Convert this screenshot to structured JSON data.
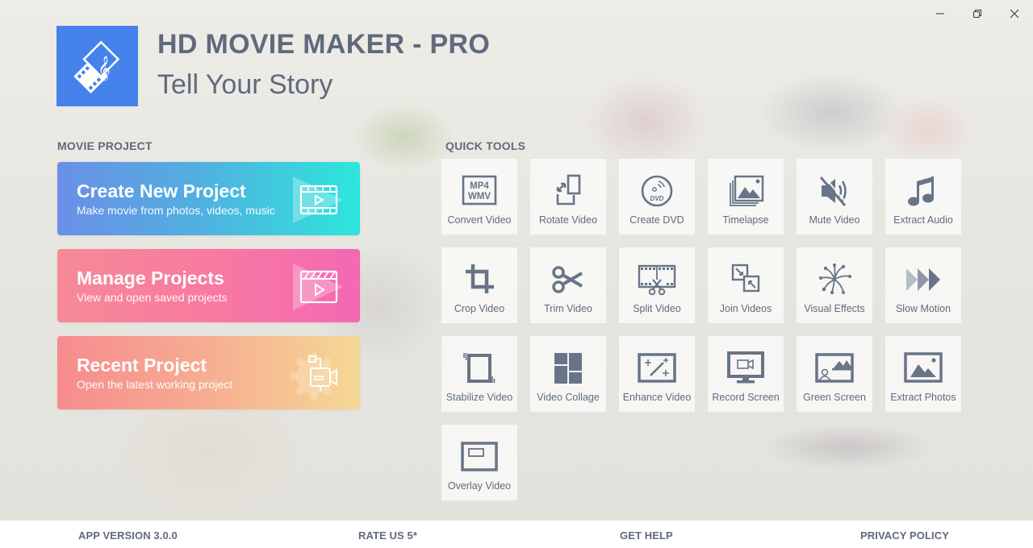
{
  "window": {
    "controls": [
      {
        "name": "minimize",
        "icon": "minimize-icon"
      },
      {
        "name": "restore",
        "icon": "restore-icon"
      },
      {
        "name": "close",
        "icon": "close-icon"
      }
    ]
  },
  "header": {
    "logo_icon": "film-music-logo-icon",
    "title": "HD MOVIE MAKER - PRO",
    "subtitle": "Tell Your Story",
    "logo_color": "#4582ec"
  },
  "movie_project": {
    "section_label": "MOVIE PROJECT",
    "cards": [
      {
        "title": "Create New Project",
        "subtitle": "Make movie from photos, videos, music",
        "icon": "film-play-icon",
        "gradient": [
          "#6b8fe8",
          "#2ee6dc"
        ]
      },
      {
        "title": "Manage Projects",
        "subtitle": "View and open saved projects",
        "icon": "clapperboard-icon",
        "gradient": [
          "#f68a96",
          "#f468b4"
        ]
      },
      {
        "title": "Recent Project",
        "subtitle": "Open the latest working project",
        "icon": "video-camera-gear-icon",
        "gradient": [
          "#f78b8e",
          "#f5d894"
        ]
      }
    ]
  },
  "quick_tools": {
    "section_label": "QUICK TOOLS",
    "icon_color": "#687487",
    "tools": [
      {
        "label": "Convert Video",
        "icon": "mp4-wmv-icon",
        "icon_text": [
          "MP4",
          "WMV"
        ]
      },
      {
        "label": "Rotate Video",
        "icon": "rotate-icon"
      },
      {
        "label": "Create DVD",
        "icon": "dvd-icon",
        "icon_text": [
          "DVD"
        ]
      },
      {
        "label": "Timelapse",
        "icon": "photo-stack-icon"
      },
      {
        "label": "Mute Video",
        "icon": "mute-icon"
      },
      {
        "label": "Extract Audio",
        "icon": "music-note-icon"
      },
      {
        "label": "Crop Video",
        "icon": "crop-icon"
      },
      {
        "label": "Trim Video",
        "icon": "scissors-icon"
      },
      {
        "label": "Split Video",
        "icon": "film-split-icon"
      },
      {
        "label": "Join Videos",
        "icon": "join-icon"
      },
      {
        "label": "Visual Effects",
        "icon": "fireworks-icon"
      },
      {
        "label": "Slow Motion",
        "icon": "fast-forward-icon"
      },
      {
        "label": "Stabilize Video",
        "icon": "stabilize-icon"
      },
      {
        "label": "Video Collage",
        "icon": "collage-icon"
      },
      {
        "label": "Enhance Video",
        "icon": "magic-wand-icon"
      },
      {
        "label": "Record Screen",
        "icon": "monitor-camera-icon"
      },
      {
        "label": "Green Screen",
        "icon": "green-screen-icon"
      },
      {
        "label": "Extract Photos",
        "icon": "image-icon"
      },
      {
        "label": "Overlay Video",
        "icon": "overlay-icon"
      }
    ]
  },
  "footer": {
    "version": "APP VERSION 3.0.0",
    "rate": "RATE US 5*",
    "help": "GET HELP",
    "privacy": "PRIVACY POLICY"
  }
}
